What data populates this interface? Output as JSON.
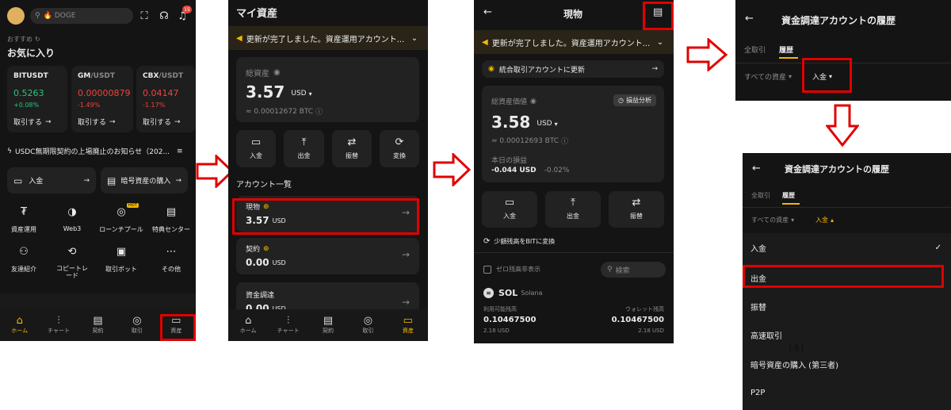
{
  "screen1": {
    "search_placeholder": "DOGE",
    "notif_count": "15",
    "section_label": "おすすめ",
    "favorites_title": "お気に入り",
    "tickers": [
      {
        "sym": "BITUSDT",
        "price": "0.5263",
        "change": "+0.08%",
        "trade": "取引する"
      },
      {
        "sym": "GM",
        "quote": "/USDT",
        "price": "0.00000879",
        "change": "-1.49%",
        "trade": "取引する"
      },
      {
        "sym": "CBX",
        "quote": "/USDT",
        "price": "0.04147",
        "change": "-1.17%",
        "trade": "取引する"
      }
    ],
    "news": "USDC無期限契約の上場廃止のお知らせ（202...",
    "deposit": "入金",
    "buy_crypto": "暗号資産の購入",
    "grid": [
      {
        "label": "資産運用",
        "icon": "₮"
      },
      {
        "label": "Web3",
        "icon": "◑"
      },
      {
        "label": "ローンチプール",
        "icon": "◎",
        "hot": "HOT"
      },
      {
        "label": "特典センター",
        "icon": "▤"
      },
      {
        "label": "友達紹介",
        "icon": "⚇"
      },
      {
        "label": "コピートレード",
        "icon": "⟲"
      },
      {
        "label": "取引ボット",
        "icon": "▣"
      },
      {
        "label": "その他",
        "icon": "⋯"
      }
    ],
    "nav": [
      "ホーム",
      "チャート",
      "契約",
      "取引",
      "資産"
    ]
  },
  "screen2": {
    "title": "マイ資産",
    "banner": "更新が完了しました。資産運用アカウント...",
    "total_label": "総資産",
    "total_value": "3.57",
    "currency": "USD",
    "btc": "≈ 0.00012672 BTC",
    "actions": [
      "入金",
      "出金",
      "振替",
      "変換"
    ],
    "accounts_title": "アカウント一覧",
    "accounts": [
      {
        "name": "現物",
        "value": "3.57",
        "unit": "USD"
      },
      {
        "name": "契約",
        "value": "0.00",
        "unit": "USD"
      },
      {
        "name": "資金調達",
        "value": "0.00",
        "unit": "USD"
      }
    ],
    "nav": [
      "ホーム",
      "チャート",
      "契約",
      "取引",
      "資産"
    ]
  },
  "screen3": {
    "title": "現物",
    "banner": "更新が完了しました。資産運用アカウント...",
    "upgrade": "統合取引アカウントに更新",
    "value_label": "総資産価値",
    "pnl_btn": "損益分析",
    "value": "3.58",
    "currency": "USD",
    "btc": "≈ 0.00012693 BTC",
    "today_label": "本日の損益",
    "today_value": "-0.044 USD",
    "today_pct": "-0.02%",
    "actions": [
      "入金",
      "出金",
      "振替"
    ],
    "convert": "少額残高をBITに変換",
    "hide_zero": "ゼロ残高非表示",
    "search": "検索",
    "coin": "SOL",
    "coin_name": "Solana",
    "avail_label": "利用可能残高",
    "wallet_label": "ウォレット残高",
    "avail": "0.10467500",
    "avail_usd": "2.18 USD",
    "wallet": "0.10467500",
    "wallet_usd": "2.18 USD"
  },
  "screen4": {
    "title": "資金調達アカウントの履歴",
    "tabs": [
      "全取引",
      "履歴"
    ],
    "filter_all": "すべての資産",
    "filter_deposit": "入金"
  },
  "screen5": {
    "title": "資金調達アカウントの履歴",
    "tabs": [
      "全取引",
      "履歴"
    ],
    "filter_all": "すべての資産",
    "filter_deposit": "入金",
    "options": [
      "入金",
      "出金",
      "振替",
      "高速取引",
      "暗号資産の購入 (第三者)",
      "P2P"
    ],
    "step": "(4)"
  }
}
